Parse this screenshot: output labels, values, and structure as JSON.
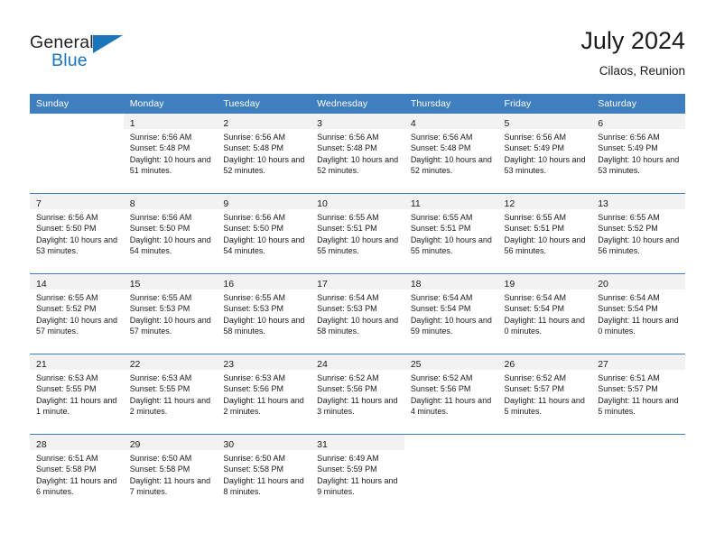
{
  "brand": {
    "name_part1": "General",
    "name_part2": "Blue",
    "accent_color": "#1b75bb"
  },
  "header": {
    "title": "July 2024",
    "subtitle": "Cilaos, Reunion",
    "header_bg": "#3f7fbf",
    "daynum_band_bg": "#f2f2f2"
  },
  "weekdays": [
    "Sunday",
    "Monday",
    "Tuesday",
    "Wednesday",
    "Thursday",
    "Friday",
    "Saturday"
  ],
  "weeks": [
    [
      {
        "day": "",
        "sunrise": "",
        "sunset": "",
        "daylight": "",
        "empty": true
      },
      {
        "day": "1",
        "sunrise": "Sunrise: 6:56 AM",
        "sunset": "Sunset: 5:48 PM",
        "daylight": "Daylight: 10 hours and 51 minutes."
      },
      {
        "day": "2",
        "sunrise": "Sunrise: 6:56 AM",
        "sunset": "Sunset: 5:48 PM",
        "daylight": "Daylight: 10 hours and 52 minutes."
      },
      {
        "day": "3",
        "sunrise": "Sunrise: 6:56 AM",
        "sunset": "Sunset: 5:48 PM",
        "daylight": "Daylight: 10 hours and 52 minutes."
      },
      {
        "day": "4",
        "sunrise": "Sunrise: 6:56 AM",
        "sunset": "Sunset: 5:48 PM",
        "daylight": "Daylight: 10 hours and 52 minutes."
      },
      {
        "day": "5",
        "sunrise": "Sunrise: 6:56 AM",
        "sunset": "Sunset: 5:49 PM",
        "daylight": "Daylight: 10 hours and 53 minutes."
      },
      {
        "day": "6",
        "sunrise": "Sunrise: 6:56 AM",
        "sunset": "Sunset: 5:49 PM",
        "daylight": "Daylight: 10 hours and 53 minutes."
      }
    ],
    [
      {
        "day": "7",
        "sunrise": "Sunrise: 6:56 AM",
        "sunset": "Sunset: 5:50 PM",
        "daylight": "Daylight: 10 hours and 53 minutes."
      },
      {
        "day": "8",
        "sunrise": "Sunrise: 6:56 AM",
        "sunset": "Sunset: 5:50 PM",
        "daylight": "Daylight: 10 hours and 54 minutes."
      },
      {
        "day": "9",
        "sunrise": "Sunrise: 6:56 AM",
        "sunset": "Sunset: 5:50 PM",
        "daylight": "Daylight: 10 hours and 54 minutes."
      },
      {
        "day": "10",
        "sunrise": "Sunrise: 6:55 AM",
        "sunset": "Sunset: 5:51 PM",
        "daylight": "Daylight: 10 hours and 55 minutes."
      },
      {
        "day": "11",
        "sunrise": "Sunrise: 6:55 AM",
        "sunset": "Sunset: 5:51 PM",
        "daylight": "Daylight: 10 hours and 55 minutes."
      },
      {
        "day": "12",
        "sunrise": "Sunrise: 6:55 AM",
        "sunset": "Sunset: 5:51 PM",
        "daylight": "Daylight: 10 hours and 56 minutes."
      },
      {
        "day": "13",
        "sunrise": "Sunrise: 6:55 AM",
        "sunset": "Sunset: 5:52 PM",
        "daylight": "Daylight: 10 hours and 56 minutes."
      }
    ],
    [
      {
        "day": "14",
        "sunrise": "Sunrise: 6:55 AM",
        "sunset": "Sunset: 5:52 PM",
        "daylight": "Daylight: 10 hours and 57 minutes."
      },
      {
        "day": "15",
        "sunrise": "Sunrise: 6:55 AM",
        "sunset": "Sunset: 5:53 PM",
        "daylight": "Daylight: 10 hours and 57 minutes."
      },
      {
        "day": "16",
        "sunrise": "Sunrise: 6:55 AM",
        "sunset": "Sunset: 5:53 PM",
        "daylight": "Daylight: 10 hours and 58 minutes."
      },
      {
        "day": "17",
        "sunrise": "Sunrise: 6:54 AM",
        "sunset": "Sunset: 5:53 PM",
        "daylight": "Daylight: 10 hours and 58 minutes."
      },
      {
        "day": "18",
        "sunrise": "Sunrise: 6:54 AM",
        "sunset": "Sunset: 5:54 PM",
        "daylight": "Daylight: 10 hours and 59 minutes."
      },
      {
        "day": "19",
        "sunrise": "Sunrise: 6:54 AM",
        "sunset": "Sunset: 5:54 PM",
        "daylight": "Daylight: 11 hours and 0 minutes."
      },
      {
        "day": "20",
        "sunrise": "Sunrise: 6:54 AM",
        "sunset": "Sunset: 5:54 PM",
        "daylight": "Daylight: 11 hours and 0 minutes."
      }
    ],
    [
      {
        "day": "21",
        "sunrise": "Sunrise: 6:53 AM",
        "sunset": "Sunset: 5:55 PM",
        "daylight": "Daylight: 11 hours and 1 minute."
      },
      {
        "day": "22",
        "sunrise": "Sunrise: 6:53 AM",
        "sunset": "Sunset: 5:55 PM",
        "daylight": "Daylight: 11 hours and 2 minutes."
      },
      {
        "day": "23",
        "sunrise": "Sunrise: 6:53 AM",
        "sunset": "Sunset: 5:56 PM",
        "daylight": "Daylight: 11 hours and 2 minutes."
      },
      {
        "day": "24",
        "sunrise": "Sunrise: 6:52 AM",
        "sunset": "Sunset: 5:56 PM",
        "daylight": "Daylight: 11 hours and 3 minutes."
      },
      {
        "day": "25",
        "sunrise": "Sunrise: 6:52 AM",
        "sunset": "Sunset: 5:56 PM",
        "daylight": "Daylight: 11 hours and 4 minutes."
      },
      {
        "day": "26",
        "sunrise": "Sunrise: 6:52 AM",
        "sunset": "Sunset: 5:57 PM",
        "daylight": "Daylight: 11 hours and 5 minutes."
      },
      {
        "day": "27",
        "sunrise": "Sunrise: 6:51 AM",
        "sunset": "Sunset: 5:57 PM",
        "daylight": "Daylight: 11 hours and 5 minutes."
      }
    ],
    [
      {
        "day": "28",
        "sunrise": "Sunrise: 6:51 AM",
        "sunset": "Sunset: 5:58 PM",
        "daylight": "Daylight: 11 hours and 6 minutes."
      },
      {
        "day": "29",
        "sunrise": "Sunrise: 6:50 AM",
        "sunset": "Sunset: 5:58 PM",
        "daylight": "Daylight: 11 hours and 7 minutes."
      },
      {
        "day": "30",
        "sunrise": "Sunrise: 6:50 AM",
        "sunset": "Sunset: 5:58 PM",
        "daylight": "Daylight: 11 hours and 8 minutes."
      },
      {
        "day": "31",
        "sunrise": "Sunrise: 6:49 AM",
        "sunset": "Sunset: 5:59 PM",
        "daylight": "Daylight: 11 hours and 9 minutes."
      },
      {
        "day": "",
        "sunrise": "",
        "sunset": "",
        "daylight": "",
        "empty": true
      },
      {
        "day": "",
        "sunrise": "",
        "sunset": "",
        "daylight": "",
        "empty": true
      },
      {
        "day": "",
        "sunrise": "",
        "sunset": "",
        "daylight": "",
        "empty": true
      }
    ]
  ]
}
